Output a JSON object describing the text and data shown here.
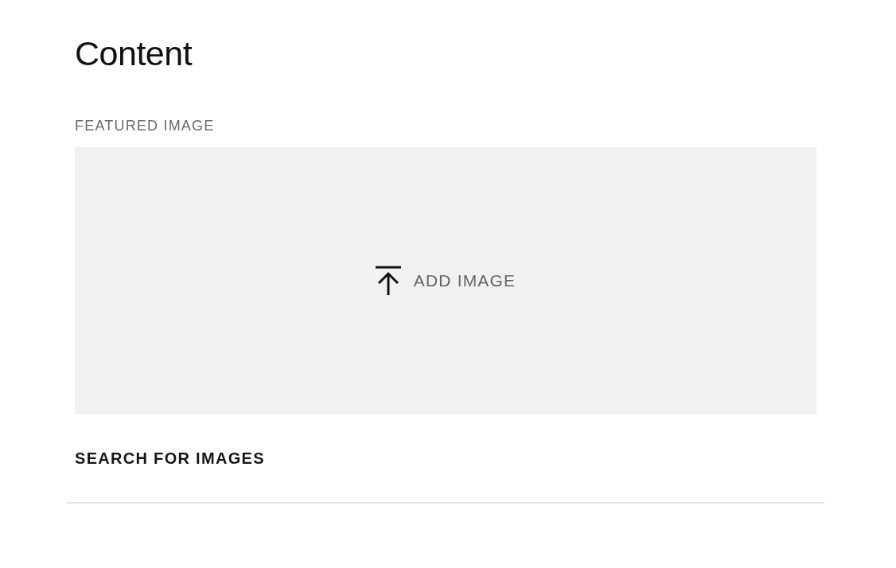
{
  "heading": "Content",
  "featured_image": {
    "label": "FEATURED IMAGE",
    "upload_label": "ADD IMAGE"
  },
  "search_link": "SEARCH FOR IMAGES"
}
